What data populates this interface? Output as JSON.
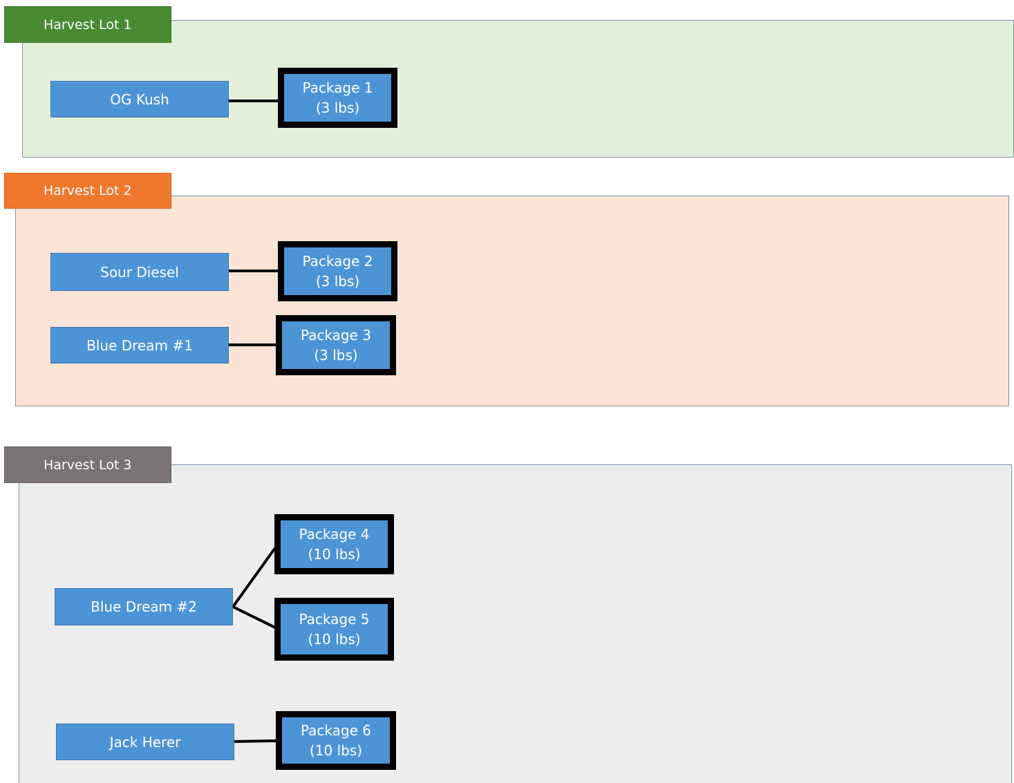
{
  "colors": {
    "lot1_header": "#4a8a33",
    "lot1_panel": "#e3f0d9",
    "lot2_header": "#f0782d",
    "lot2_panel": "#fbe4d6",
    "lot3_header": "#7a7373",
    "lot3_panel": "#ededee",
    "node_fill": "#4d94d6",
    "package_border": "#000000"
  },
  "lots": [
    {
      "label": "Harvest Lot 1",
      "plants": [
        {
          "name": "OG Kush",
          "packages": [
            {
              "name": "Package 1",
              "weight": "(3 lbs)"
            }
          ]
        }
      ]
    },
    {
      "label": "Harvest Lot 2",
      "plants": [
        {
          "name": "Sour Diesel",
          "packages": [
            {
              "name": "Package 2",
              "weight": "(3 lbs)"
            }
          ]
        },
        {
          "name": "Blue Dream #1",
          "packages": [
            {
              "name": "Package 3",
              "weight": "(3 lbs)"
            }
          ]
        }
      ]
    },
    {
      "label": "Harvest Lot 3",
      "plants": [
        {
          "name": "Blue Dream #2",
          "packages": [
            {
              "name": "Package 4",
              "weight": "(10 lbs)"
            },
            {
              "name": "Package 5",
              "weight": "(10 lbs)"
            }
          ]
        },
        {
          "name": "Jack Herer",
          "packages": [
            {
              "name": "Package 6",
              "weight": "(10 lbs)"
            }
          ]
        }
      ]
    }
  ]
}
